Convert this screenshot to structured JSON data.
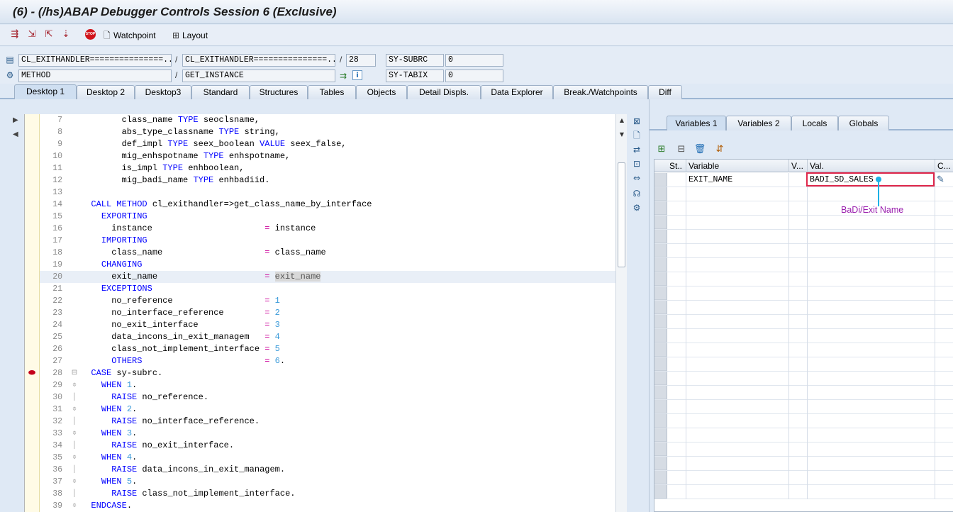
{
  "window": {
    "title": "(6) - (/hs)ABAP Debugger Controls Session 6 (Exclusive)"
  },
  "toolbar": {
    "stop_text": "STOP",
    "watchpoint_label": "Watchpoint",
    "layout_label": "Layout"
  },
  "header": {
    "program": "CL_EXITHANDLER===============...",
    "include": "CL_EXITHANDLER===============...",
    "line": "28",
    "event_type": "METHOD",
    "event": "GET_INSTANCE",
    "sysvar1_name": "SY-SUBRC",
    "sysvar1_value": "0",
    "sysvar2_name": "SY-TABIX",
    "sysvar2_value": "0",
    "sep": "/"
  },
  "tabs": [
    "Desktop 1",
    "Desktop 2",
    "Desktop3",
    "Standard",
    "Structures",
    "Tables",
    "Objects",
    "Detail Displs.",
    "Data Explorer",
    "Break./Watchpoints",
    "Diff"
  ],
  "code": {
    "lines": [
      {
        "n": "7",
        "segs": [
          [
            "p",
            "        class_name "
          ],
          [
            "k",
            "TYPE"
          ],
          [
            "p",
            " seoclsname,"
          ]
        ]
      },
      {
        "n": "8",
        "segs": [
          [
            "p",
            "        abs_type_classname "
          ],
          [
            "k",
            "TYPE"
          ],
          [
            "p",
            " string,"
          ]
        ]
      },
      {
        "n": "9",
        "segs": [
          [
            "p",
            "        def_impl "
          ],
          [
            "k",
            "TYPE"
          ],
          [
            "p",
            " seex_boolean "
          ],
          [
            "k",
            "VALUE"
          ],
          [
            "p",
            " seex_false,"
          ]
        ]
      },
      {
        "n": "10",
        "segs": [
          [
            "p",
            "        mig_enhspotname "
          ],
          [
            "k",
            "TYPE"
          ],
          [
            "p",
            " enhspotname,"
          ]
        ]
      },
      {
        "n": "11",
        "segs": [
          [
            "p",
            "        is_impl "
          ],
          [
            "k",
            "TYPE"
          ],
          [
            "p",
            " enhboolean,"
          ]
        ]
      },
      {
        "n": "12",
        "segs": [
          [
            "p",
            "        mig_badi_name "
          ],
          [
            "k",
            "TYPE"
          ],
          [
            "p",
            " enhbadiid."
          ]
        ]
      },
      {
        "n": "13",
        "segs": []
      },
      {
        "n": "14",
        "segs": [
          [
            "p",
            "  "
          ],
          [
            "k",
            "CALL METHOD"
          ],
          [
            "p",
            " cl_exithandler=>get_class_name_by_interface"
          ]
        ]
      },
      {
        "n": "15",
        "segs": [
          [
            "p",
            "    "
          ],
          [
            "k",
            "EXPORTING"
          ]
        ]
      },
      {
        "n": "16",
        "segs": [
          [
            "p",
            "      instance                      "
          ],
          [
            "o",
            "="
          ],
          [
            "p",
            " instance"
          ]
        ]
      },
      {
        "n": "17",
        "segs": [
          [
            "p",
            "    "
          ],
          [
            "k",
            "IMPORTING"
          ]
        ]
      },
      {
        "n": "18",
        "segs": [
          [
            "p",
            "      class_name                    "
          ],
          [
            "o",
            "="
          ],
          [
            "p",
            " class_name"
          ]
        ]
      },
      {
        "n": "19",
        "segs": [
          [
            "p",
            "    "
          ],
          [
            "k",
            "CHANGING"
          ]
        ]
      },
      {
        "n": "20",
        "hl": true,
        "segs": [
          [
            "p",
            "      exit_name                     "
          ],
          [
            "o",
            "="
          ],
          [
            "p",
            " "
          ],
          [
            "h",
            "exit_name"
          ]
        ]
      },
      {
        "n": "21",
        "segs": [
          [
            "p",
            "    "
          ],
          [
            "k",
            "EXCEPTIONS"
          ]
        ]
      },
      {
        "n": "22",
        "segs": [
          [
            "p",
            "      no_reference                  "
          ],
          [
            "o",
            "="
          ],
          [
            "p",
            " "
          ],
          [
            "d",
            "1"
          ]
        ]
      },
      {
        "n": "23",
        "segs": [
          [
            "p",
            "      no_interface_reference        "
          ],
          [
            "o",
            "="
          ],
          [
            "p",
            " "
          ],
          [
            "d",
            "2"
          ]
        ]
      },
      {
        "n": "24",
        "segs": [
          [
            "p",
            "      no_exit_interface             "
          ],
          [
            "o",
            "="
          ],
          [
            "p",
            " "
          ],
          [
            "d",
            "3"
          ]
        ]
      },
      {
        "n": "25",
        "segs": [
          [
            "p",
            "      data_incons_in_exit_managem   "
          ],
          [
            "o",
            "="
          ],
          [
            "p",
            " "
          ],
          [
            "d",
            "4"
          ]
        ]
      },
      {
        "n": "26",
        "segs": [
          [
            "p",
            "      class_not_implement_interface "
          ],
          [
            "o",
            "="
          ],
          [
            "p",
            " "
          ],
          [
            "d",
            "5"
          ]
        ]
      },
      {
        "n": "27",
        "segs": [
          [
            "p",
            "      "
          ],
          [
            "k",
            "OTHERS"
          ],
          [
            "p",
            "                        "
          ],
          [
            "o",
            "="
          ],
          [
            "p",
            " "
          ],
          [
            "d",
            "6"
          ],
          [
            "p",
            "."
          ]
        ]
      },
      {
        "n": "28",
        "fold": "⊟",
        "segs": [
          [
            "p",
            "  "
          ],
          [
            "k",
            "CASE"
          ],
          [
            "p",
            " sy-subrc."
          ]
        ]
      },
      {
        "n": "29",
        "fold": "⌽",
        "segs": [
          [
            "p",
            "    "
          ],
          [
            "k",
            "WHEN"
          ],
          [
            "p",
            " "
          ],
          [
            "d",
            "1"
          ],
          [
            "p",
            "."
          ]
        ]
      },
      {
        "n": "30",
        "fold": "│",
        "segs": [
          [
            "p",
            "      "
          ],
          [
            "k",
            "RAISE"
          ],
          [
            "p",
            " no_reference."
          ]
        ]
      },
      {
        "n": "31",
        "fold": "⌽",
        "segs": [
          [
            "p",
            "    "
          ],
          [
            "k",
            "WHEN"
          ],
          [
            "p",
            " "
          ],
          [
            "d",
            "2"
          ],
          [
            "p",
            "."
          ]
        ]
      },
      {
        "n": "32",
        "fold": "│",
        "segs": [
          [
            "p",
            "      "
          ],
          [
            "k",
            "RAISE"
          ],
          [
            "p",
            " no_interface_reference."
          ]
        ]
      },
      {
        "n": "33",
        "fold": "⌽",
        "segs": [
          [
            "p",
            "    "
          ],
          [
            "k",
            "WHEN"
          ],
          [
            "p",
            " "
          ],
          [
            "d",
            "3"
          ],
          [
            "p",
            "."
          ]
        ]
      },
      {
        "n": "34",
        "fold": "│",
        "segs": [
          [
            "p",
            "      "
          ],
          [
            "k",
            "RAISE"
          ],
          [
            "p",
            " no_exit_interface."
          ]
        ]
      },
      {
        "n": "35",
        "fold": "⌽",
        "segs": [
          [
            "p",
            "    "
          ],
          [
            "k",
            "WHEN"
          ],
          [
            "p",
            " "
          ],
          [
            "d",
            "4"
          ],
          [
            "p",
            "."
          ]
        ]
      },
      {
        "n": "36",
        "fold": "│",
        "segs": [
          [
            "p",
            "      "
          ],
          [
            "k",
            "RAISE"
          ],
          [
            "p",
            " data_incons_in_exit_managem."
          ]
        ]
      },
      {
        "n": "37",
        "fold": "⌽",
        "segs": [
          [
            "p",
            "    "
          ],
          [
            "k",
            "WHEN"
          ],
          [
            "p",
            " "
          ],
          [
            "d",
            "5"
          ],
          [
            "p",
            "."
          ]
        ]
      },
      {
        "n": "38",
        "fold": "│",
        "segs": [
          [
            "p",
            "      "
          ],
          [
            "k",
            "RAISE"
          ],
          [
            "p",
            " class_not_implement_interface."
          ]
        ]
      },
      {
        "n": "39",
        "fold": "⌽",
        "segs": [
          [
            "p",
            "  "
          ],
          [
            "k",
            "ENDCASE"
          ],
          [
            "p",
            "."
          ]
        ]
      }
    ]
  },
  "right_panel": {
    "tabs": [
      "Variables 1",
      "Variables 2",
      "Locals",
      "Globals"
    ],
    "columns": [
      "St..",
      "Variable",
      "V...",
      "Val.",
      "C..."
    ],
    "rows": [
      {
        "variable": "EXIT_NAME",
        "value": "BADI_SD_SALES"
      }
    ],
    "annotation": "BaDi/Exit Name"
  },
  "colors": {
    "keyword": "#0000ff",
    "number": "#3a9ad9",
    "operator": "#cc0099",
    "annotation_box": "#e0274b",
    "annotation_line": "#1db1e6",
    "annotation_text": "#9a1fae"
  }
}
